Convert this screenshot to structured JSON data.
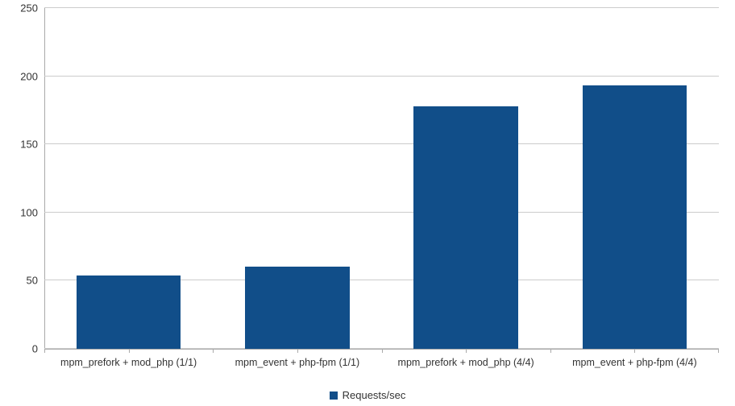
{
  "chart_data": {
    "type": "bar",
    "categories": [
      "mpm_prefork + mod_php (1/1)",
      "mpm_event + php-fpm (1/1)",
      "mpm_prefork + mod_php (4/4)",
      "mpm_event + php-fpm (4/4)"
    ],
    "series": [
      {
        "name": "Requests/sec",
        "values": [
          54,
          60,
          178,
          193
        ]
      }
    ],
    "ylim": [
      0,
      250
    ],
    "yticks": [
      0,
      50,
      100,
      150,
      200,
      250
    ],
    "title": "",
    "xlabel": "",
    "ylabel": "",
    "bar_color": "#114e89"
  },
  "legend": {
    "label": "Requests/sec"
  },
  "yaxis": {
    "t0": "0",
    "t1": "50",
    "t2": "100",
    "t3": "150",
    "t4": "200",
    "t5": "250"
  },
  "xaxis": {
    "c0": "mpm_prefork + mod_php (1/1)",
    "c1": "mpm_event + php-fpm (1/1)",
    "c2": "mpm_prefork + mod_php (4/4)",
    "c3": "mpm_event + php-fpm (4/4)"
  }
}
